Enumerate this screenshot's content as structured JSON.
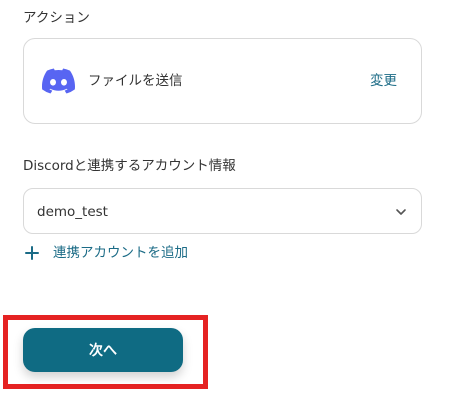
{
  "action_section": {
    "label": "アクション",
    "action_name": "ファイルを送信",
    "change_label": "変更",
    "icon": "discord-icon"
  },
  "account_section": {
    "label": "Discordと連携するアカウント情報",
    "selected_account": "demo_test",
    "add_account_label": "連携アカウントを追加"
  },
  "footer": {
    "next_label": "次へ"
  },
  "colors": {
    "accent": "#1b6b86",
    "button_bg": "#0f6b83",
    "discord": "#5865f2",
    "highlight": "#e52222",
    "border": "#d9d9d9"
  }
}
